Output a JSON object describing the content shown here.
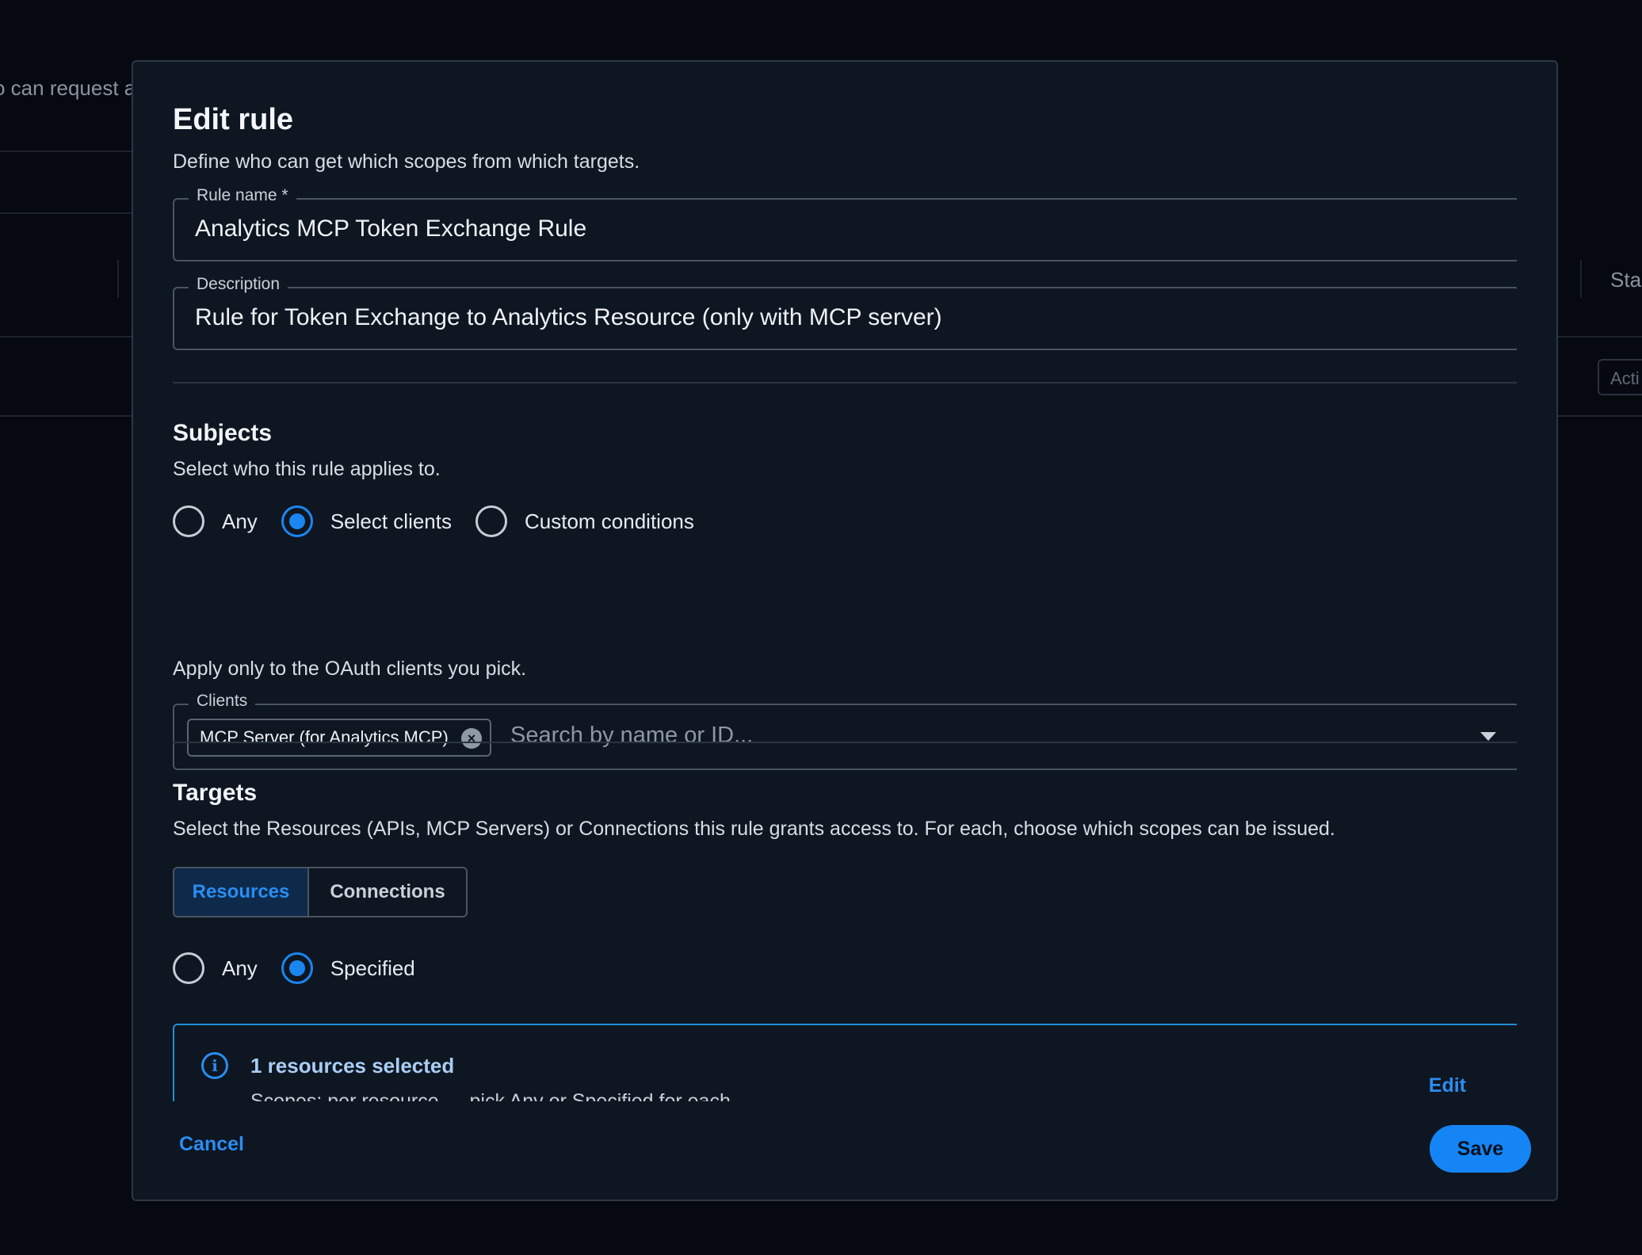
{
  "background": {
    "left_text": "o can request a",
    "right_header_text": "Sta",
    "right_chip_text": "Acti"
  },
  "modal": {
    "title": "Edit rule",
    "subtitle": "Define who can get which scopes from which targets.",
    "rule_name": {
      "label": "Rule name *",
      "value": "Analytics MCP Token Exchange Rule"
    },
    "description": {
      "label": "Description",
      "value": "Rule for Token Exchange to Analytics Resource (only with MCP server)"
    },
    "subjects": {
      "title": "Subjects",
      "description": "Select who this rule applies to.",
      "options": [
        {
          "label": "Any",
          "checked": false
        },
        {
          "label": "Select clients",
          "checked": true
        },
        {
          "label": "Custom conditions",
          "checked": false
        }
      ],
      "helper": "Apply only to the OAuth clients you pick.",
      "clients_field": {
        "label": "Clients",
        "chip": "MCP Server (for Analytics MCP)",
        "placeholder": "Search by name or ID..."
      }
    },
    "targets": {
      "title": "Targets",
      "description": "Select the Resources (APIs, MCP Servers) or Connections this rule grants access to. For each, choose which scopes can be issued.",
      "tabs": [
        {
          "label": "Resources",
          "active": true
        },
        {
          "label": "Connections",
          "active": false
        }
      ],
      "options": [
        {
          "label": "Any",
          "checked": false
        },
        {
          "label": "Specified",
          "checked": true
        }
      ],
      "info": {
        "title": "1 resources selected",
        "subtitle": "Scopes: per resource — pick Any or Specified for each",
        "edit_label": "Edit"
      }
    },
    "footer": {
      "cancel_label": "Cancel",
      "save_label": "Save"
    }
  },
  "colors": {
    "accent": "#1585f5",
    "modal_bg": "#0e1621",
    "backdrop": "#060a10",
    "info_border": "#1f8fd8"
  }
}
